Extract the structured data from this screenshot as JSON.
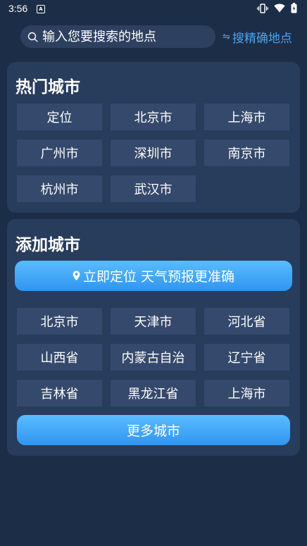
{
  "status_bar": {
    "time": "3:56",
    "app_icon_letter": "A"
  },
  "search": {
    "placeholder": "输入您要搜索的地点",
    "precise_icon": "⇋",
    "precise_label": "搜精确地点"
  },
  "hot_cities": {
    "title": "热门城市",
    "items": [
      "定位",
      "北京市",
      "上海市",
      "广州市",
      "深圳市",
      "南京市",
      "杭州市",
      "武汉市"
    ]
  },
  "add_city": {
    "title": "添加城市",
    "locate_label": "立即定位 天气预报更准确",
    "provinces": [
      "北京市",
      "天津市",
      "河北省",
      "山西省",
      "内蒙古自治",
      "辽宁省",
      "吉林省",
      "黑龙江省",
      "上海市"
    ],
    "more_label": "更多城市"
  },
  "colors": {
    "background": "#1c2d47",
    "card": "#283c5c",
    "city_button": "#34496b",
    "accent": "#4aa3f0",
    "button_gradient_top": "#5bbcff",
    "button_gradient_bottom": "#2f95f0"
  },
  "icons": {
    "search": "search-icon",
    "swap": "swap-icon",
    "location_pin": "location-pin-icon",
    "vibrate": "vibrate-icon",
    "wifi": "wifi-icon",
    "battery": "battery-icon"
  }
}
